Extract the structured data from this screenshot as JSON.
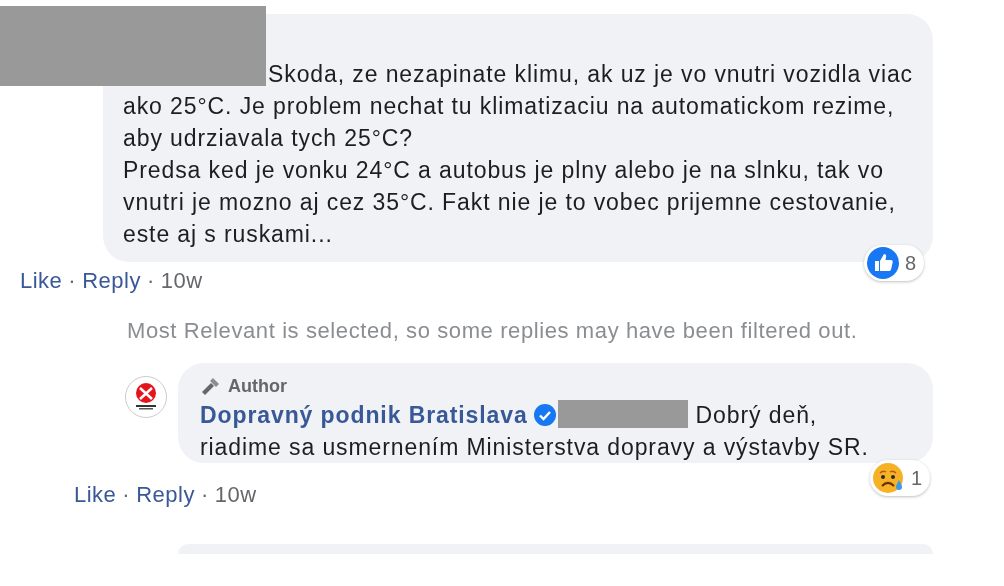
{
  "comment": {
    "paragraphs": [
      "Skoda, ze nezapinate klimu, ak uz je vo vnutri vozidla viac ako 25°C. Je problem nechat tu klimatizaciu na automatickom rezime, aby udrziavala tych 25°C?",
      "Predsa ked je vonku 24°C a autobus je plny alebo je na slnku, tak vo vnutri je mozno aj cez 35°C. Fakt nie je to vobec prijemne cestovanie, este aj s ruskami..."
    ],
    "reaction": {
      "kind": "like",
      "count": "8"
    },
    "actions": [
      "Like",
      "Reply"
    ],
    "separator": "·",
    "time": "10w"
  },
  "filter_notice": "Most Relevant is selected, so some replies may have been filtered out.",
  "reply": {
    "badge": "Author",
    "name": "Dopravný podnik Bratislava",
    "verified": true,
    "text_first": "Dobrý deň,",
    "text": "riadime sa usmernením Ministerstva dopravy a výstavby SR.",
    "reaction": {
      "kind": "sad",
      "count": "1"
    },
    "actions": [
      "Like",
      "Reply"
    ],
    "separator": "·",
    "time": "10w"
  }
}
